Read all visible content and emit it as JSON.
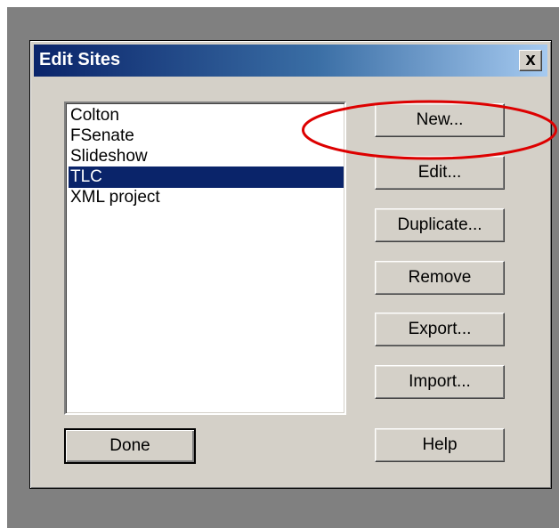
{
  "dialog": {
    "title": "Edit Sites",
    "close_label": "x",
    "sites": [
      "Colton",
      "FSenate",
      "Slideshow",
      "TLC",
      "XML project"
    ],
    "selected_site": "TLC",
    "buttons": {
      "new": "New...",
      "edit": "Edit...",
      "duplicate": "Duplicate...",
      "remove": "Remove",
      "export": "Export...",
      "import": "Import...",
      "done": "Done",
      "help": "Help"
    }
  },
  "colors": {
    "title_bar": "#0a246a",
    "selection": "#0a246a",
    "annotation": "#dd0000"
  }
}
